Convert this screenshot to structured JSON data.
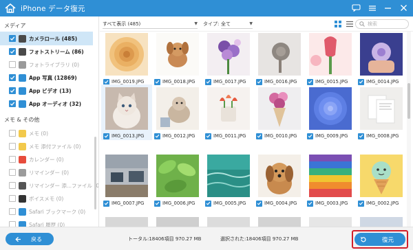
{
  "app": {
    "title": "iPhone データ復元"
  },
  "sidebar": {
    "media_header": "メディア",
    "memo_header": "メモ & その他",
    "media_items": [
      {
        "label": "カメラロール (485)",
        "checked": true,
        "selected": true,
        "active": true,
        "icon": "camera-roll-icon",
        "color": "#4a4a4a"
      },
      {
        "label": "フォトストリーム (86)",
        "checked": true,
        "selected": false,
        "active": true,
        "icon": "photo-stream-icon",
        "color": "#4a4a4a"
      },
      {
        "label": "フォトライブラリ (0)",
        "checked": false,
        "selected": false,
        "active": false,
        "icon": "photo-library-icon",
        "color": "#9a9a9a"
      },
      {
        "label": "App 写真 (12869)",
        "checked": true,
        "selected": false,
        "active": true,
        "icon": "app-photo-icon",
        "color": "#2f8fd5"
      },
      {
        "label": "App ビデオ (13)",
        "checked": true,
        "selected": false,
        "active": true,
        "icon": "app-video-icon",
        "color": "#2f8fd5"
      },
      {
        "label": "App オーディオ (32)",
        "checked": true,
        "selected": false,
        "active": true,
        "icon": "app-audio-icon",
        "color": "#2f8fd5"
      }
    ],
    "memo_items": [
      {
        "label": "メモ (0)",
        "icon": "memo-icon",
        "color": "#f2c94c"
      },
      {
        "label": "メモ 添付ファイル (0)",
        "icon": "memo-attachment-icon",
        "color": "#f2c94c"
      },
      {
        "label": "カレンダー (0)",
        "icon": "calendar-icon",
        "color": "#e74c3c"
      },
      {
        "label": "リマインダー (0)",
        "icon": "reminder-icon",
        "color": "#9b9b9b"
      },
      {
        "label": "リマインダー 添...ファイル (0)",
        "icon": "reminder-attachment-icon",
        "color": "#555555"
      },
      {
        "label": "ボイスメモ (0)",
        "icon": "voice-memo-icon",
        "color": "#333333"
      },
      {
        "label": "Safari ブックマーク (0)",
        "icon": "safari-bookmark-icon",
        "color": "#2f8fd5"
      },
      {
        "label": "Safari 履歴 (0)",
        "icon": "safari-history-icon",
        "color": "#2f8fd5"
      }
    ]
  },
  "toolbar": {
    "filter_value": "すべて表示 (485)",
    "type_label": "タイプ:",
    "type_value": "全て",
    "search_placeholder": "検索"
  },
  "photos": [
    {
      "name": "IMG_0019.JPG",
      "checked": true
    },
    {
      "name": "IMG_0018.JPG",
      "checked": true
    },
    {
      "name": "IMG_0017.JPG",
      "checked": true
    },
    {
      "name": "IMG_0016.JPG",
      "checked": true
    },
    {
      "name": "IMG_0015.JPG",
      "checked": true
    },
    {
      "name": "IMG_0014.JPG",
      "checked": true
    },
    {
      "name": "IMG_0013.JPG",
      "checked": true
    },
    {
      "name": "IMG_0012.JPG",
      "checked": true
    },
    {
      "name": "IMG_0011.JPG",
      "checked": true
    },
    {
      "name": "IMG_0010.JPG",
      "checked": true
    },
    {
      "name": "IMG_0009.JPG",
      "checked": true
    },
    {
      "name": "IMG_0008.JPG",
      "checked": true
    },
    {
      "name": "IMG_0007.JPG",
      "checked": true
    },
    {
      "name": "IMG_0006.JPG",
      "checked": true
    },
    {
      "name": "IMG_0005.JPG",
      "checked": true
    },
    {
      "name": "IMG_0004.JPG",
      "checked": true
    },
    {
      "name": "IMG_0003.JPG",
      "checked": true
    },
    {
      "name": "IMG_0002.JPG",
      "checked": true
    }
  ],
  "footer": {
    "back_label": "戻る",
    "total_text": "トータル:18406項目 970.27 MB",
    "selected_text": "選択された:18406項目 970.27 MB",
    "restore_label": "復元"
  },
  "colors": {
    "accent": "#2f8fd5",
    "highlight": "#d21f2a",
    "selected_row": "#cfe6f7"
  }
}
